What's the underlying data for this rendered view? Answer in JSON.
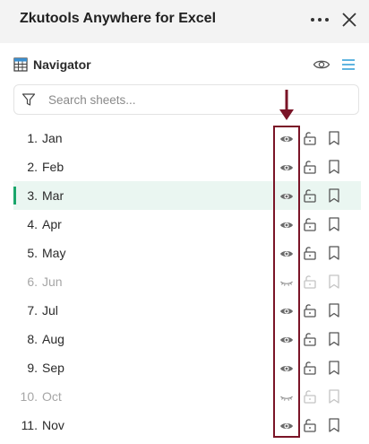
{
  "app": {
    "title": "Zkutools Anywhere for Excel",
    "more_icon": "ellipsis-icon",
    "close_icon": "close-icon"
  },
  "navigator": {
    "title": "Navigator",
    "eye_icon": "eye-icon",
    "menu_icon": "menu-icon"
  },
  "search": {
    "placeholder": "Search sheets...",
    "value": ""
  },
  "sheets": [
    {
      "num": "1.",
      "name": "Jan",
      "hidden": false,
      "active": false
    },
    {
      "num": "2.",
      "name": "Feb",
      "hidden": false,
      "active": false
    },
    {
      "num": "3.",
      "name": "Mar",
      "hidden": false,
      "active": true
    },
    {
      "num": "4.",
      "name": "Apr",
      "hidden": false,
      "active": false
    },
    {
      "num": "5.",
      "name": "May",
      "hidden": false,
      "active": false
    },
    {
      "num": "6.",
      "name": "Jun",
      "hidden": true,
      "active": false
    },
    {
      "num": "7.",
      "name": "Jul",
      "hidden": false,
      "active": false
    },
    {
      "num": "8.",
      "name": "Aug",
      "hidden": false,
      "active": false
    },
    {
      "num": "9.",
      "name": "Sep",
      "hidden": false,
      "active": false
    },
    {
      "num": "10.",
      "name": "Oct",
      "hidden": true,
      "active": false
    },
    {
      "num": "11.",
      "name": "Nov",
      "hidden": false,
      "active": false
    }
  ],
  "colors": {
    "accent": "#1aa66b",
    "active_row": "#eaf6f1",
    "annotation": "#7a1427",
    "nav_menu": "#2a9bd6"
  }
}
